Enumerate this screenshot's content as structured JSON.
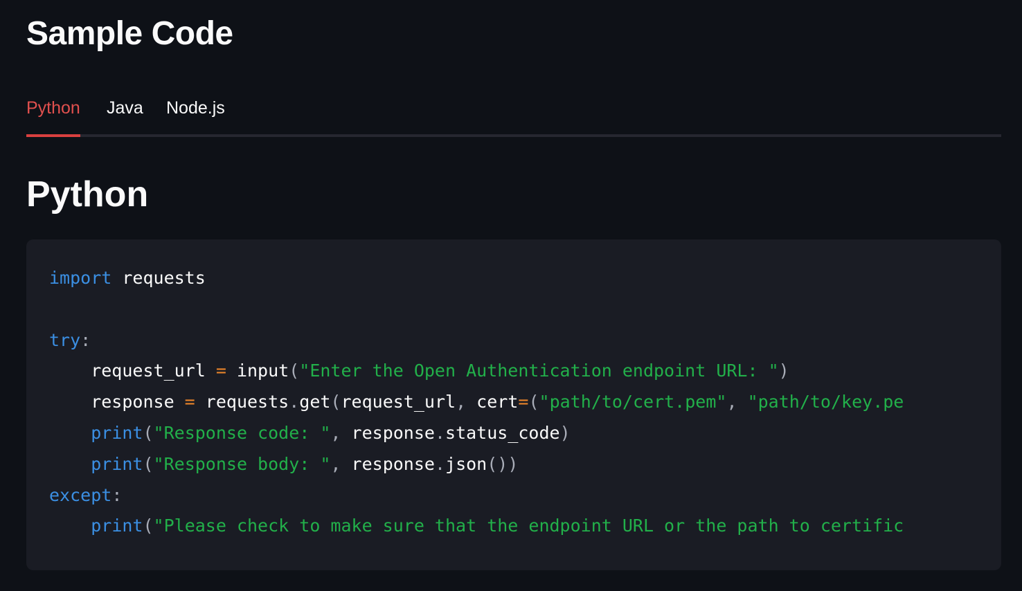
{
  "header": {
    "title": "Sample Code"
  },
  "tabs": [
    {
      "label": "Python",
      "active": true
    },
    {
      "label": "Java",
      "active": false
    },
    {
      "label": "Node.js",
      "active": false
    }
  ],
  "section": {
    "title": "Python"
  },
  "colors": {
    "background": "#0e1117",
    "code_background": "#1a1c24",
    "tab_active": "#e0504e",
    "keyword": "#3b8fe3",
    "string": "#22b04a",
    "operator": "#e8832a"
  },
  "code": {
    "language": "python",
    "lines": [
      [
        [
          "kw",
          "import"
        ],
        [
          "pl",
          " requests"
        ]
      ],
      [],
      [
        [
          "kw",
          "try"
        ],
        [
          "pun",
          ":"
        ]
      ],
      [
        [
          "pl",
          "    request_url "
        ],
        [
          "op",
          "="
        ],
        [
          "pl",
          " input"
        ],
        [
          "pun",
          "("
        ],
        [
          "str",
          "\"Enter the Open Authentication endpoint URL: \""
        ],
        [
          "pun",
          ")"
        ]
      ],
      [
        [
          "pl",
          "    response "
        ],
        [
          "op",
          "="
        ],
        [
          "pl",
          " requests"
        ],
        [
          "pun",
          "."
        ],
        [
          "pl",
          "get"
        ],
        [
          "pun",
          "("
        ],
        [
          "pl",
          "request_url"
        ],
        [
          "pun",
          ","
        ],
        [
          "pl",
          " cert"
        ],
        [
          "op",
          "="
        ],
        [
          "pun",
          "("
        ],
        [
          "str",
          "\"path/to/cert.pem\""
        ],
        [
          "pun",
          ","
        ],
        [
          "pl",
          " "
        ],
        [
          "str",
          "\"path/to/key.pe"
        ]
      ],
      [
        [
          "pl",
          "    "
        ],
        [
          "kw",
          "print"
        ],
        [
          "pun",
          "("
        ],
        [
          "str",
          "\"Response code: \""
        ],
        [
          "pun",
          ","
        ],
        [
          "pl",
          " response"
        ],
        [
          "pun",
          "."
        ],
        [
          "pl",
          "status_code"
        ],
        [
          "pun",
          ")"
        ]
      ],
      [
        [
          "pl",
          "    "
        ],
        [
          "kw",
          "print"
        ],
        [
          "pun",
          "("
        ],
        [
          "str",
          "\"Response body: \""
        ],
        [
          "pun",
          ","
        ],
        [
          "pl",
          " response"
        ],
        [
          "pun",
          "."
        ],
        [
          "pl",
          "json"
        ],
        [
          "pun",
          "())"
        ]
      ],
      [
        [
          "kw",
          "except"
        ],
        [
          "pun",
          ":"
        ]
      ],
      [
        [
          "pl",
          "    "
        ],
        [
          "kw",
          "print"
        ],
        [
          "pun",
          "("
        ],
        [
          "str",
          "\"Please check to make sure that the endpoint URL or the path to certific"
        ]
      ]
    ]
  }
}
